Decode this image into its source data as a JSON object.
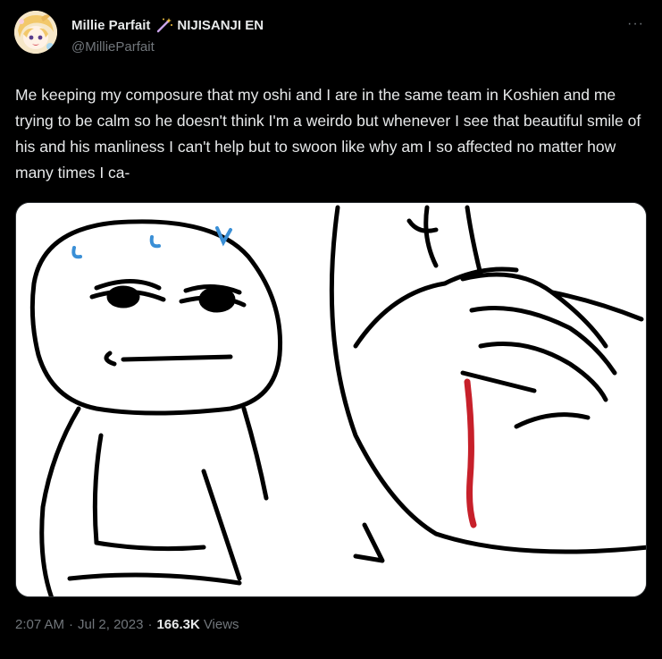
{
  "author": {
    "display_name": "Millie Parfait",
    "affiliation": "NIJISANJI EN",
    "handle": "@MillieParfait",
    "wand_emoji": "wand-sparkles-icon"
  },
  "more_icon": "···",
  "tweet": {
    "text": "Me keeping my composure that my oshi and I are in the same team in Koshien and me trying to be calm so he doesn't think I'm a weirdo but whenever I see that beautiful smile of his and his manliness I can't help but to swoon like why am I so affected no matter how many times I ca-"
  },
  "meta": {
    "time": "2:07 AM",
    "separator": "·",
    "date": "Jul 2, 2023",
    "views_count": "166.3K",
    "views_label": "Views"
  },
  "colors": {
    "background": "#000000",
    "text": "#e7e9ea",
    "muted": "#71767b",
    "blood": "#c7202a"
  }
}
